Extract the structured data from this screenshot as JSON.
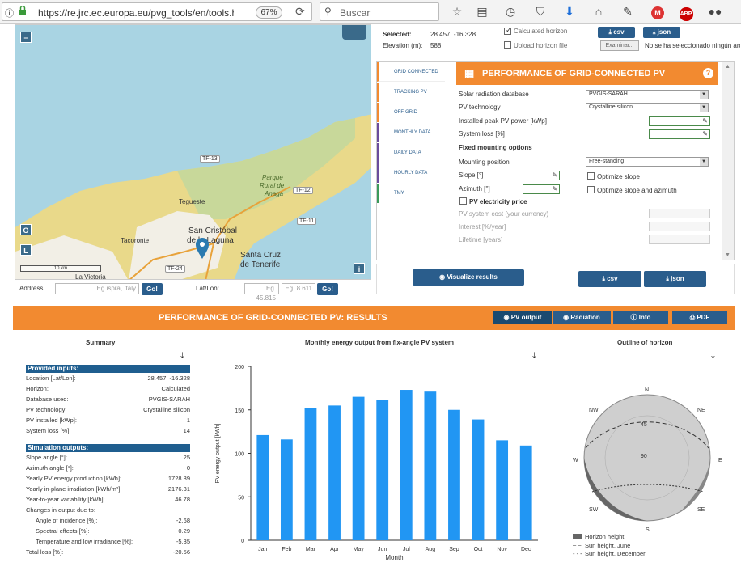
{
  "browser": {
    "url": "https://re.jrc.ec.europa.eu/pvg_tools/en/tools.ht",
    "zoom": "67%",
    "search_placeholder": "Buscar"
  },
  "map": {
    "places": [
      "Tegueste",
      "San Cristóbal",
      "de la Laguna",
      "Tacoronte",
      "Santa Cruz",
      "de Tenerife",
      "La Victoria",
      "Parque",
      "Rural de",
      "Anaga"
    ],
    "roads": [
      "TF-13",
      "TF-12",
      "TF-11",
      "TF-24"
    ],
    "scale": "10 km",
    "layer_buttons": [
      "O",
      "L"
    ]
  },
  "address": {
    "address_label": "Address:",
    "address_placeholder": "Eg.ispra, Italy",
    "go1": "Go!",
    "latlon_label": "Lat/Lon:",
    "lat_placeholder": "Eg. 45.815",
    "lon_placeholder": "Eg. 8.611",
    "go2": "Go!"
  },
  "selection": {
    "selected_label": "Selected:",
    "selected_value": "28.457, -16.328",
    "elevation_label": "Elevation (m):",
    "elevation_value": "588",
    "calc_horizon": "Calculated horizon",
    "upload_horizon": "Upload horizon file",
    "csv": "csv",
    "json": "json",
    "browse": "Examinar...",
    "no_file": "No se ha seleccionado ningún archivo"
  },
  "tabs": [
    {
      "label": "GRID CONNECTED",
      "color": "#f28a30"
    },
    {
      "label": "TRACKING PV",
      "color": "#f28a30"
    },
    {
      "label": "OFF-GRID",
      "color": "#f28a30"
    },
    {
      "label": "MONTHLY DATA",
      "color": "#6a4c9c"
    },
    {
      "label": "DAILY DATA",
      "color": "#6a4c9c"
    },
    {
      "label": "HOURLY DATA",
      "color": "#6a4c9c"
    },
    {
      "label": "TMY",
      "color": "#3a9a5a"
    }
  ],
  "panel": {
    "title": "PERFORMANCE OF GRID-CONNECTED PV",
    "radiation_db_label": "Solar radiation database",
    "radiation_db_value": "PVGIS-SARAH",
    "pv_tech_label": "PV technology",
    "pv_tech_value": "Crystalline silicon",
    "peak_power_label": "Installed peak PV power [kWp]",
    "system_loss_label": "System loss [%]",
    "fixed_mounting": "Fixed mounting options",
    "mounting_pos_label": "Mounting position",
    "mounting_pos_value": "Free-standing",
    "slope_label": "Slope [°]",
    "azimuth_label": "Azimuth [°]",
    "opt_slope": "Optimize slope",
    "opt_slope_azimuth": "Optimize slope and azimuth",
    "pv_price": "PV electricity price",
    "system_cost_label": "PV system cost (your currency)",
    "interest_label": "Interest [%/year]",
    "lifetime_label": "Lifetime [years]"
  },
  "actions": {
    "visualize": "Visualize results",
    "csv": "csv",
    "json": "json"
  },
  "results": {
    "title": "PERFORMANCE OF GRID-CONNECTED PV: RESULTS",
    "tabs": [
      "PV output",
      "Radiation",
      "Info",
      "PDF"
    ],
    "summary_title": "Summary",
    "provided_inputs": "Provided inputs:",
    "inputs": [
      {
        "k": "Location [Lat/Lon]:",
        "v": "28.457, -16.328"
      },
      {
        "k": "Horizon:",
        "v": "Calculated"
      },
      {
        "k": "Database used:",
        "v": "PVGIS-SARAH"
      },
      {
        "k": "PV technology:",
        "v": "Crystalline silicon"
      },
      {
        "k": "PV installed [kWp]:",
        "v": "1"
      },
      {
        "k": "System loss [%]:",
        "v": "14"
      }
    ],
    "simulation_outputs": "Simulation outputs:",
    "outputs": [
      {
        "k": "Slope angle [°]:",
        "v": "25"
      },
      {
        "k": "Azimuth angle [°]:",
        "v": "0"
      },
      {
        "k": "Yearly PV energy production [kWh]:",
        "v": "1728.89"
      },
      {
        "k": "Yearly in-plane irradiation [kWh/m²]:",
        "v": "2176.31"
      },
      {
        "k": "Year-to-year variability [kWh]:",
        "v": "46.78"
      },
      {
        "k": "Changes in output due to:",
        "v": ""
      },
      {
        "k": "Angle of incidence [%]:",
        "v": "-2.68"
      },
      {
        "k": "Spectral effects [%]:",
        "v": "0.29"
      },
      {
        "k": "Temperature and low irradiance [%]:",
        "v": "-5.35"
      },
      {
        "k": "Total loss [%]:",
        "v": "-20.56"
      }
    ],
    "horizon_title": "Outline of horizon",
    "compass": [
      "N",
      "NE",
      "E",
      "SE",
      "S",
      "SW",
      "W",
      "NW"
    ],
    "horizon_ticks": [
      "45",
      "90"
    ],
    "legend": [
      "Horizon height",
      "Sun height, June",
      "Sun height, December"
    ]
  },
  "chart_data": {
    "type": "bar",
    "title": "Monthly energy output from fix-angle PV system",
    "xlabel": "Month",
    "ylabel": "PV energy output [kWh]",
    "ylim": [
      0,
      200
    ],
    "yticks": [
      0,
      50,
      100,
      150,
      200
    ],
    "categories": [
      "Jan",
      "Feb",
      "Mar",
      "Apr",
      "May",
      "Jun",
      "Jul",
      "Aug",
      "Sep",
      "Oct",
      "Nov",
      "Dec"
    ],
    "values": [
      121,
      116,
      152,
      155,
      165,
      161,
      173,
      171,
      150,
      139,
      115,
      109
    ],
    "color": "#2196f3"
  }
}
